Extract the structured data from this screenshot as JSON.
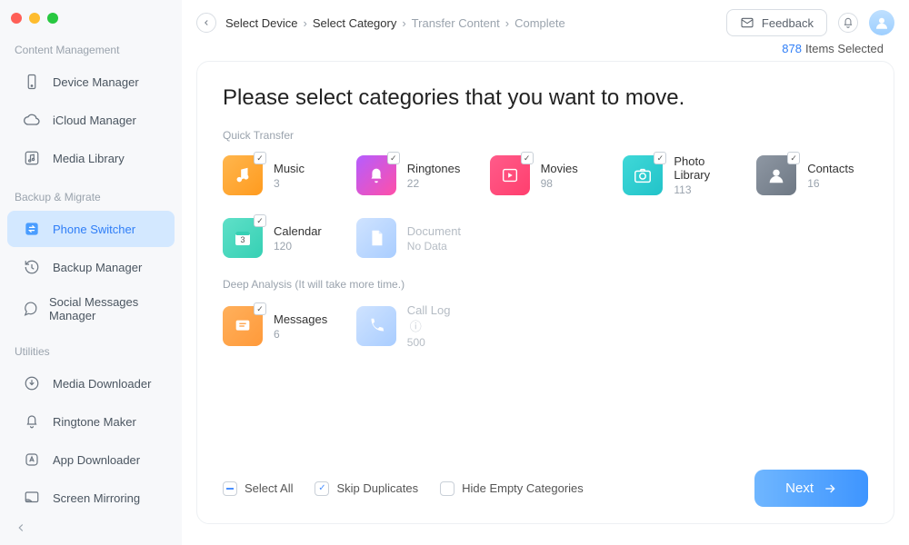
{
  "sidebar": {
    "sections": {
      "content_management": "Content Management",
      "backup_migrate": "Backup & Migrate",
      "utilities": "Utilities"
    },
    "items": {
      "device_manager": "Device Manager",
      "icloud_manager": "iCloud Manager",
      "media_library": "Media Library",
      "phone_switcher": "Phone Switcher",
      "backup_manager": "Backup Manager",
      "social_messages": "Social Messages Manager",
      "media_downloader": "Media Downloader",
      "ringtone_maker": "Ringtone Maker",
      "app_downloader": "App Downloader",
      "screen_mirroring": "Screen Mirroring"
    }
  },
  "topbar": {
    "feedback": "Feedback",
    "breadcrumb": {
      "select_device": "Select Device",
      "select_category": "Select Category",
      "transfer_content": "Transfer Content",
      "complete": "Complete"
    }
  },
  "status": {
    "count": "878",
    "suffix": "Items Selected"
  },
  "page": {
    "title": "Please select categories that you want to move.",
    "quick_transfer": "Quick Transfer",
    "deep_analysis": "Deep Analysis (It will take more time.)"
  },
  "categories": {
    "music": {
      "name": "Music",
      "count": "3"
    },
    "ringtones": {
      "name": "Ringtones",
      "count": "22"
    },
    "movies": {
      "name": "Movies",
      "count": "98"
    },
    "photos": {
      "name": "Photo Library",
      "count": "113"
    },
    "contacts": {
      "name": "Contacts",
      "count": "16"
    },
    "calendar": {
      "name": "Calendar",
      "count": "120"
    },
    "document": {
      "name": "Document",
      "count": "No Data"
    },
    "messages": {
      "name": "Messages",
      "count": "6"
    },
    "calllog": {
      "name": "Call Log",
      "count": "500"
    }
  },
  "footer": {
    "select_all": "Select All",
    "skip_duplicates": "Skip Duplicates",
    "hide_empty": "Hide Empty Categories",
    "next": "Next"
  }
}
